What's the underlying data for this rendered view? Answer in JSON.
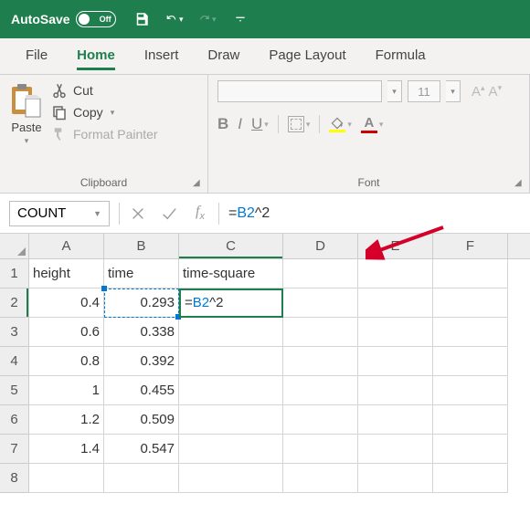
{
  "titlebar": {
    "autosave_label": "AutoSave",
    "autosave_state": "Off"
  },
  "tabs": {
    "file": "File",
    "home": "Home",
    "insert": "Insert",
    "draw": "Draw",
    "page_layout": "Page Layout",
    "formulas": "Formula"
  },
  "clipboard": {
    "paste": "Paste",
    "cut": "Cut",
    "copy": "Copy",
    "format_painter": "Format Painter",
    "group_label": "Clipboard"
  },
  "font": {
    "name": "",
    "size": "11",
    "group_label": "Font"
  },
  "namebox": {
    "value": "COUNT"
  },
  "formula_bar": {
    "value": "=B2^2"
  },
  "columns": [
    "A",
    "B",
    "C",
    "D",
    "E",
    "F"
  ],
  "rows": [
    {
      "n": "1",
      "A": "height",
      "B": "time",
      "C": "time-square"
    },
    {
      "n": "2",
      "A": "0.4",
      "B": "0.293",
      "C": "=B2^2",
      "editing": true
    },
    {
      "n": "3",
      "A": "0.6",
      "B": "0.338"
    },
    {
      "n": "4",
      "A": "0.8",
      "B": "0.392"
    },
    {
      "n": "5",
      "A": "1",
      "B": "0.455"
    },
    {
      "n": "6",
      "A": "1.2",
      "B": "0.509"
    },
    {
      "n": "7",
      "A": "1.4",
      "B": "0.547"
    },
    {
      "n": "8"
    }
  ]
}
